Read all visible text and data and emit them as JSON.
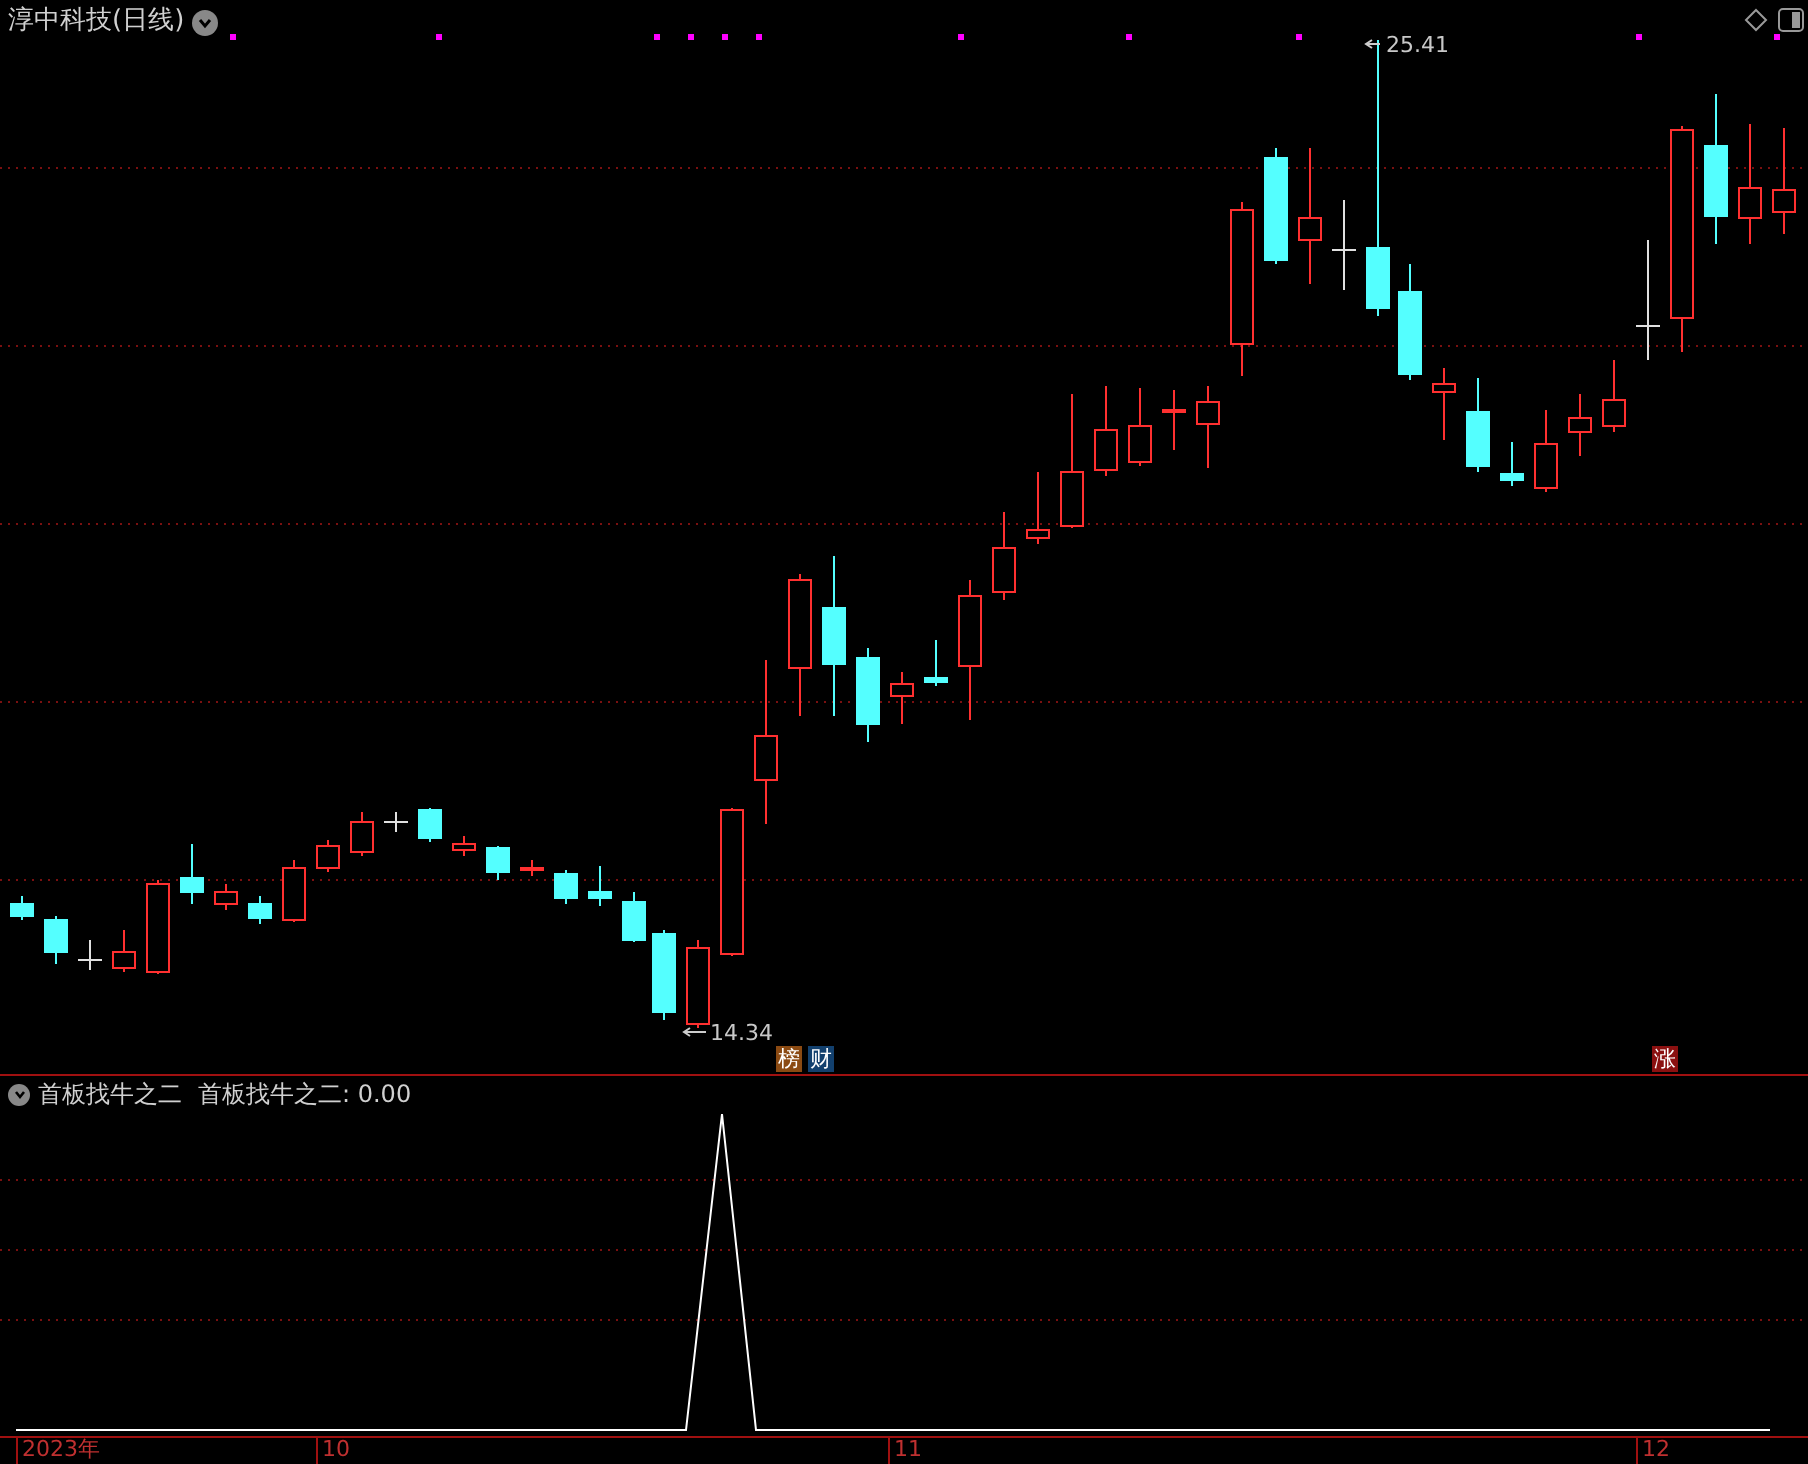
{
  "chart_header": {
    "title": "淳中科技(日线)"
  },
  "price_labels": [
    {
      "kind": "high",
      "text": "25.41"
    },
    {
      "kind": "low",
      "text": "14.34"
    }
  ],
  "event_badges": [
    {
      "text": "榜",
      "color": "#8b4a12"
    },
    {
      "text": "财",
      "color": "#12406e"
    },
    {
      "text": "涨",
      "color": "#8b1010"
    }
  ],
  "indicator": {
    "name": "首板找牛之二",
    "reading": "首板找牛之二: 0.00"
  },
  "time_axis": [
    "2023年",
    "10",
    "11",
    "12"
  ]
}
